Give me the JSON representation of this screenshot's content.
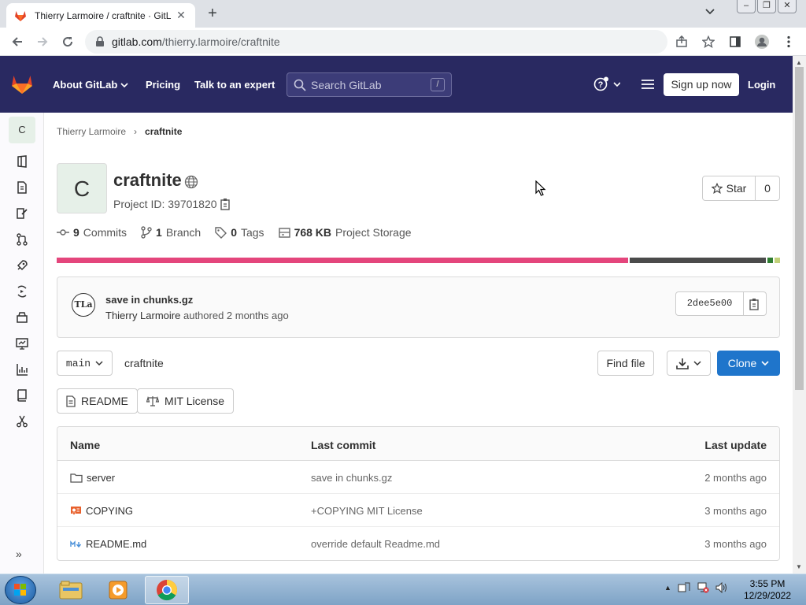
{
  "browser": {
    "tab_title": "Thierry Larmoire / craftnite · GitL",
    "close_tab": "✕",
    "new_tab": "+",
    "url_host": "gitlab.com",
    "url_path": "/thierry.larmoire/craftnite"
  },
  "gitlab_nav": {
    "about": "About GitLab",
    "pricing": "Pricing",
    "talk": "Talk to an expert",
    "search_placeholder": "Search GitLab",
    "search_shortcut": "/",
    "signup": "Sign up now",
    "login": "Login"
  },
  "sidebar": {
    "project_initial": "C",
    "items": [
      "project-overview",
      "repository",
      "issues",
      "merge-requests",
      "ci-cd",
      "deployments",
      "packages",
      "monitor",
      "analytics",
      "wiki",
      "snippets"
    ],
    "expand": "»"
  },
  "breadcrumb": {
    "owner": "Thierry Larmoire",
    "separator": "›",
    "project": "craftnite"
  },
  "project": {
    "initial": "C",
    "name": "craftnite",
    "id_label": "Project ID: 39701820",
    "star_label": "Star",
    "star_count": "0"
  },
  "stats": {
    "commits_count": "9",
    "commits_label": "Commits",
    "branch_count": "1",
    "branch_label": "Branch",
    "tags_count": "0",
    "tags_label": "Tags",
    "storage_size": "768 KB",
    "storage_label": "Project Storage"
  },
  "languages": [
    {
      "color": "#e4467c",
      "fraction": 0.79
    },
    {
      "color": "#4b4b4b",
      "fraction": 0.19
    },
    {
      "color": "#2f7d32",
      "fraction": 0.01
    },
    {
      "color": "#c2d17a",
      "fraction": 0.01
    }
  ],
  "last_commit": {
    "avatar": "TLa",
    "title": "save in chunks.gz",
    "author": "Thierry Larmoire",
    "meta": "authored 2 months ago",
    "sha": "2dee5e00"
  },
  "toolbar": {
    "branch": "main",
    "path": "craftnite",
    "find_file": "Find file",
    "clone": "Clone"
  },
  "quick_links": {
    "readme": "README",
    "license": "MIT License"
  },
  "file_table": {
    "headers": {
      "name": "Name",
      "commit": "Last commit",
      "update": "Last update"
    },
    "rows": [
      {
        "name": "server",
        "commit": "save in chunks.gz",
        "update": "2 months ago"
      },
      {
        "name": "COPYING",
        "commit": "+COPYING MIT License",
        "update": "3 months ago"
      },
      {
        "name": "README.md",
        "commit": "override default Readme.md",
        "update": "3 months ago"
      }
    ]
  },
  "taskbar": {
    "time": "3:55 PM",
    "date": "12/29/2022"
  }
}
